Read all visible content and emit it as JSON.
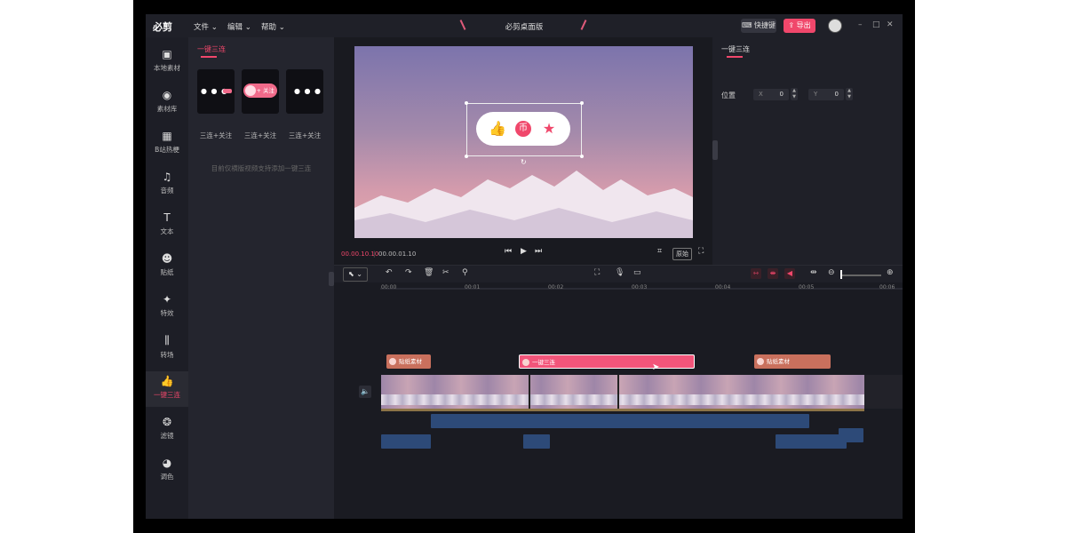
{
  "app": {
    "logo": "必剪",
    "title": "必剪桌面版"
  },
  "menu": [
    {
      "label": "文件 ⌄"
    },
    {
      "label": "编辑 ⌄"
    },
    {
      "label": "帮助 ⌄"
    }
  ],
  "header": {
    "shortcut": "⌨ 快捷键",
    "export": "⇪ 导出"
  },
  "window_controls": {
    "minimize": "–",
    "maximize": "□",
    "close": "✕"
  },
  "left_nav": [
    {
      "label": "本地素材",
      "icon": "folder-icon",
      "glyph": "▣"
    },
    {
      "label": "素材库",
      "icon": "library-icon",
      "glyph": "◉"
    },
    {
      "label": "B站热梗",
      "icon": "bilibili-tv-icon",
      "glyph": "▦"
    },
    {
      "label": "音频",
      "icon": "music-icon",
      "glyph": "♫"
    },
    {
      "label": "文本",
      "icon": "text-icon",
      "glyph": "T"
    },
    {
      "label": "贴纸",
      "icon": "sticker-icon",
      "glyph": "☻"
    },
    {
      "label": "特效",
      "icon": "effects-icon",
      "glyph": "✦"
    },
    {
      "label": "转场",
      "icon": "transition-icon",
      "glyph": "⫼"
    },
    {
      "label": "一键三连",
      "icon": "thumbs-up-icon",
      "glyph": "👍"
    },
    {
      "label": "滤镜",
      "icon": "filter-icon",
      "glyph": "❂"
    },
    {
      "label": "调色",
      "icon": "palette-icon",
      "glyph": "◕"
    }
  ],
  "left_nav_active": "一键三连",
  "asset_panel": {
    "tab": "一键三连",
    "items": [
      {
        "label": "三连+关注"
      },
      {
        "label": "三连+关注"
      },
      {
        "label": "三连+关注"
      }
    ],
    "follow_pill": "+ 关注",
    "hint": "目前仅横版视频支持添加一键三连"
  },
  "preview": {
    "overlay_icons": [
      "thumbs-up-icon",
      "coin-icon",
      "star-icon"
    ],
    "current_time": "00.00.10.10",
    "separator": "|",
    "total_time": "00.00.01.10",
    "original_ratio_button": "原始"
  },
  "properties": {
    "tab": "一键三连",
    "position_label": "位置",
    "x_axis": "X",
    "x_value": "0",
    "y_axis": "Y",
    "y_value": "0"
  },
  "timeline": {
    "ruler": [
      "00:00",
      "00:01",
      "00:02",
      "00:03",
      "00:04",
      "00:05",
      "00:06"
    ],
    "sticker_clip_1": "贴纸素材",
    "sanlian_clip": "一键三连",
    "sticker_clip_2": "贴纸素材"
  },
  "colors": {
    "accent": "#f0476b",
    "window_bg": "#1a1b22",
    "panel_bg": "#24252e",
    "sticker_clip": "#c9705d",
    "sanlian_clip": "#f2557a",
    "audio_clip": "#2d4a78"
  }
}
